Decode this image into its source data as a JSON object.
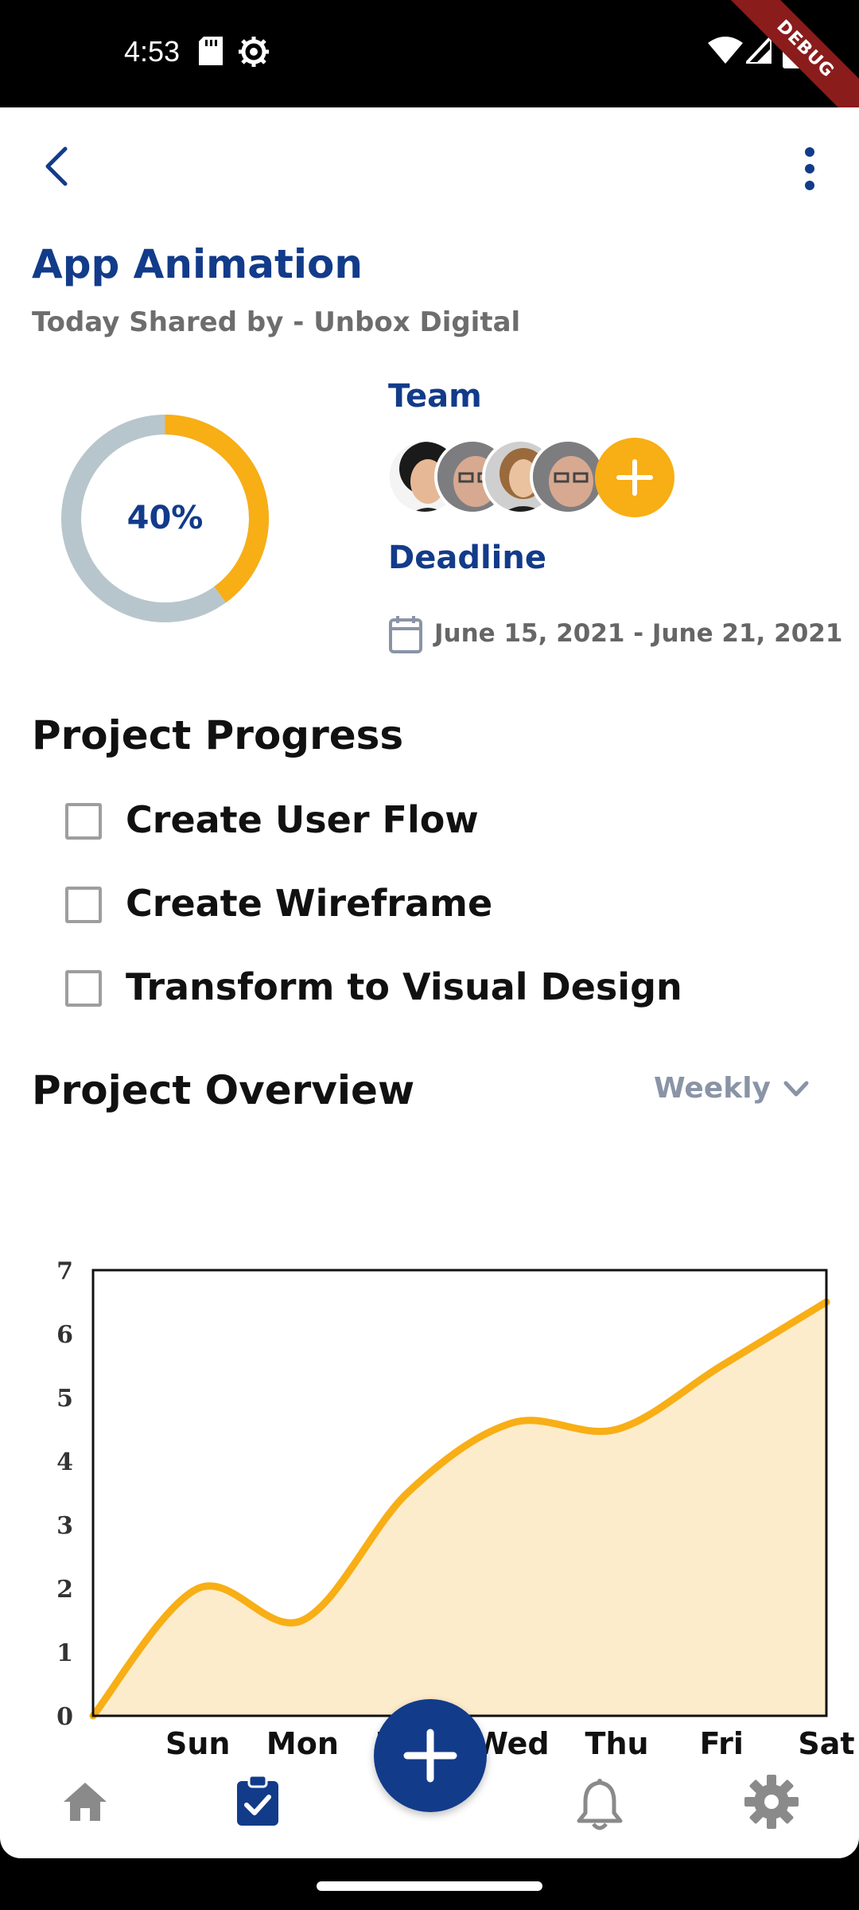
{
  "status_bar": {
    "time": "4:53",
    "debug_label": "DEBUG"
  },
  "header": {
    "title": "App Animation",
    "subtitle": "Today Shared by - Unbox Digital"
  },
  "progress": {
    "percent_label": "40%",
    "value": 0.4,
    "track_color": "#b7c6cc",
    "fill_color": "#f8ae15"
  },
  "team": {
    "label": "Team",
    "member_count": 4
  },
  "deadline": {
    "label": "Deadline",
    "range": "June 15, 2021 - June 21, 2021"
  },
  "project_progress": {
    "title": "Project Progress",
    "tasks": [
      {
        "label": "Create User Flow",
        "checked": false
      },
      {
        "label": "Create Wireframe",
        "checked": false
      },
      {
        "label": "Transform to Visual Design",
        "checked": false
      }
    ]
  },
  "overview": {
    "title": "Project Overview",
    "period": "Weekly"
  },
  "chart_data": {
    "type": "area",
    "x": [
      "",
      "Sun",
      "Mon",
      "Tue",
      "Wed",
      "Thu",
      "Fri",
      "Sat"
    ],
    "categories": [
      "Sun",
      "Mon",
      "Tue",
      "Wed",
      "Thu",
      "Fri",
      "Sat"
    ],
    "values": [
      0,
      2,
      1.5,
      3.5,
      4.6,
      4.5,
      5.5,
      6.5
    ],
    "yticks": [
      "0",
      "1",
      "2",
      "3",
      "4",
      "5",
      "6",
      "7"
    ],
    "ylim": [
      0,
      7
    ],
    "title": "",
    "xlabel": "",
    "ylabel": "",
    "line_color": "#f8ae15",
    "fill_color": "#fdeccb"
  },
  "colors": {
    "primary": "#123b8a",
    "accent": "#f8ae15"
  },
  "nav": {
    "items": [
      {
        "icon": "home-icon",
        "active": false
      },
      {
        "icon": "clipboard-check-icon",
        "active": true
      },
      {
        "icon": "bell-icon",
        "active": false
      },
      {
        "icon": "gear-icon",
        "active": false
      }
    ],
    "fab_icon": "plus-icon"
  }
}
